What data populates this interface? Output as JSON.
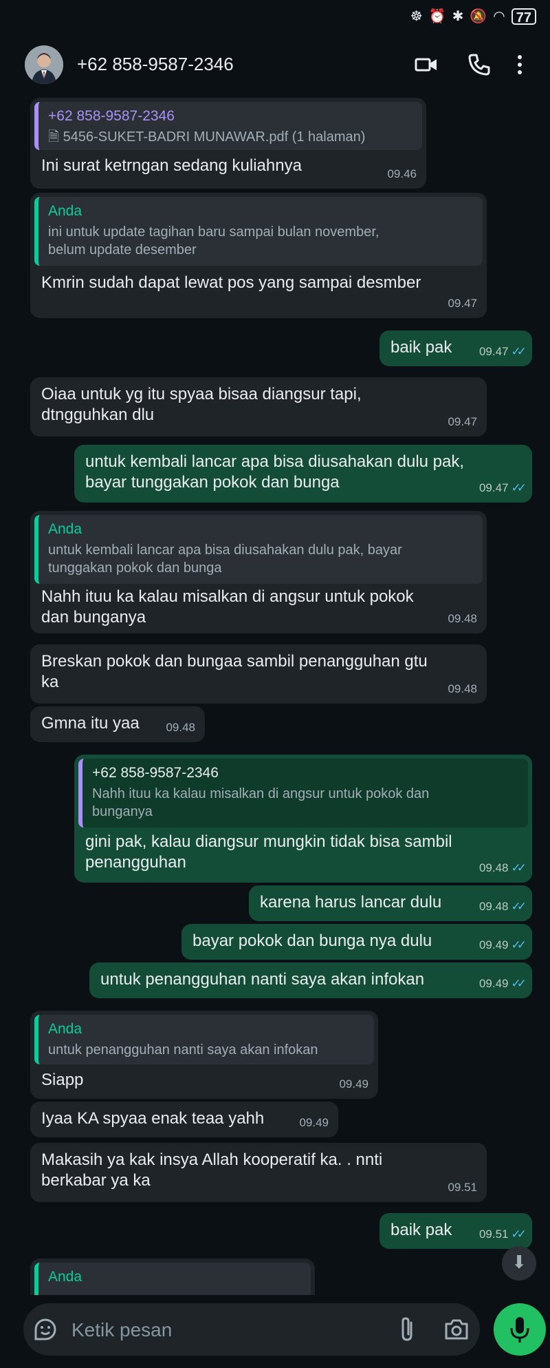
{
  "status_bar": {
    "battery": "77"
  },
  "header": {
    "contact_name": "+62 858-9587-2346"
  },
  "messages": [
    {
      "direction": "in",
      "quote_author": "+62 858-9587-2346",
      "quote_text": "5456-SUKET-BADRI MUNAWAR.pdf (1 halaman)",
      "text": "Ini surat ketrngan sedang kuliahnya",
      "time": "09.46"
    },
    {
      "direction": "in",
      "quote_author": "Anda",
      "quote_line1": "ini untuk update tagihan baru sampai bulan november,",
      "quote_line2": "belum update desember",
      "text": "Kmrin sudah dapat lewat pos yang sampai desmber",
      "time": "09.47"
    },
    {
      "direction": "out",
      "text": "baik pak",
      "time": "09.47"
    },
    {
      "direction": "in",
      "line1": "Oiaa untuk yg itu spyaa bisaa diangsur tapi,",
      "line2": "dtngguhkan dlu",
      "time": "09.47"
    },
    {
      "direction": "out",
      "line1": "untuk kembali lancar apa bisa diusahakan dulu pak,",
      "line2": "bayar tunggakan pokok dan bunga",
      "time": "09.47"
    },
    {
      "direction": "in",
      "quote_author": "Anda",
      "quote_line1": "untuk kembali lancar apa bisa diusahakan dulu pak, bayar",
      "quote_line2": "tunggakan pokok dan bunga",
      "line1": "Nahh ituu ka kalau misalkan di angsur untuk pokok",
      "line2": "dan bunganya",
      "time": "09.48"
    },
    {
      "direction": "in",
      "line1": "Breskan pokok dan bungaa sambil penangguhan gtu",
      "line2": "ka",
      "time": "09.48"
    },
    {
      "direction": "in",
      "text": "Gmna itu yaa",
      "time": "09.48"
    },
    {
      "direction": "out",
      "quote_author": "+62 858-9587-2346",
      "quote_line1": "Nahh ituu ka kalau misalkan di angsur untuk pokok dan",
      "quote_line2": "bunganya",
      "line1": "gini pak, kalau diangsur mungkin tidak bisa sambil",
      "line2": "penangguhan",
      "time": "09.48"
    },
    {
      "direction": "out",
      "text": "karena harus lancar dulu",
      "time": "09.48"
    },
    {
      "direction": "out",
      "text": "bayar pokok dan bunga nya dulu",
      "time": "09.49"
    },
    {
      "direction": "out",
      "text": "untuk penangguhan nanti saya akan infokan",
      "time": "09.49"
    },
    {
      "direction": "in",
      "quote_author": "Anda",
      "quote_text": "untuk penangguhan nanti saya akan infokan",
      "text": "Siapp",
      "time": "09.49"
    },
    {
      "direction": "in",
      "text": "Iyaa KA spyaa enak teaa yahh",
      "time": "09.49"
    },
    {
      "direction": "in",
      "line1": "Makasih ya kak insya Allah kooperatif ka. .  nnti",
      "line2": "berkabar ya ka",
      "time": "09.51"
    },
    {
      "direction": "out",
      "text": "baik pak",
      "time": "09.51"
    },
    {
      "direction": "in",
      "quote_author": "Anda"
    }
  ],
  "input": {
    "placeholder": "Ketik pesan"
  },
  "colors": {
    "background": "#0b1014",
    "incoming_bubble": "#1f2428",
    "outgoing_bubble": "#134d37",
    "read_ticks": "#53bdeb",
    "mic_button": "#21c063",
    "quote_you": "#06cf9c",
    "quote_contact": "#a991f7"
  }
}
